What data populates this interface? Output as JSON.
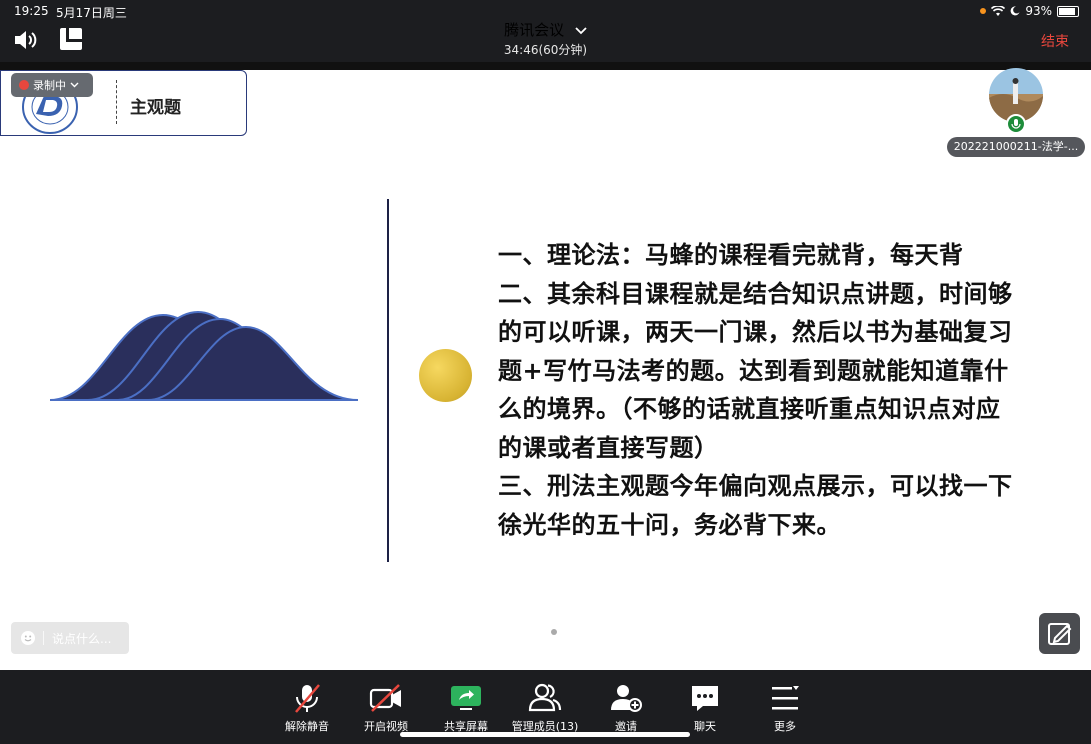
{
  "status": {
    "time": "19:25",
    "date": "5月17日周三",
    "battery": "93%"
  },
  "meeting": {
    "title": "腾讯会议",
    "duration": "34:46(60分钟)",
    "end_label": "结束"
  },
  "recording": {
    "label": "录制中"
  },
  "slide": {
    "title": "主观题",
    "lines": [
      "一、理论法：马蜂的课程看完就背，每天背",
      "二、其余科目课程就是结合知识点讲题，时间够",
      "的可以听课，两天一门课，然后以书为基础复习",
      "题+写竹马法考的题。达到看到题就能知道靠什",
      "么的境界。（不够的话就直接听重点知识点对应",
      "的课或者直接写题）",
      "三、刑法主观题今年偏向观点展示，可以找一下",
      "徐光华的五十问，务必背下来。"
    ]
  },
  "participant": {
    "name": "202221000211-法学-..."
  },
  "chat": {
    "placeholder": "说点什么..."
  },
  "toolbar": {
    "items": [
      {
        "label": "解除静音",
        "icon": "mic-muted-icon"
      },
      {
        "label": "开启视频",
        "icon": "video-off-icon"
      },
      {
        "label": "共享屏幕",
        "icon": "share-screen-icon"
      },
      {
        "label": "管理成员(13)",
        "icon": "members-icon"
      },
      {
        "label": "邀请",
        "icon": "invite-icon"
      },
      {
        "label": "聊天",
        "icon": "chat-icon"
      },
      {
        "label": "更多",
        "icon": "more-icon"
      }
    ]
  },
  "colors": {
    "end": "#e8473d",
    "share_green": "#2db35d",
    "slide_accent": "#2a3a7a",
    "mic_green": "#1d8c3a"
  }
}
